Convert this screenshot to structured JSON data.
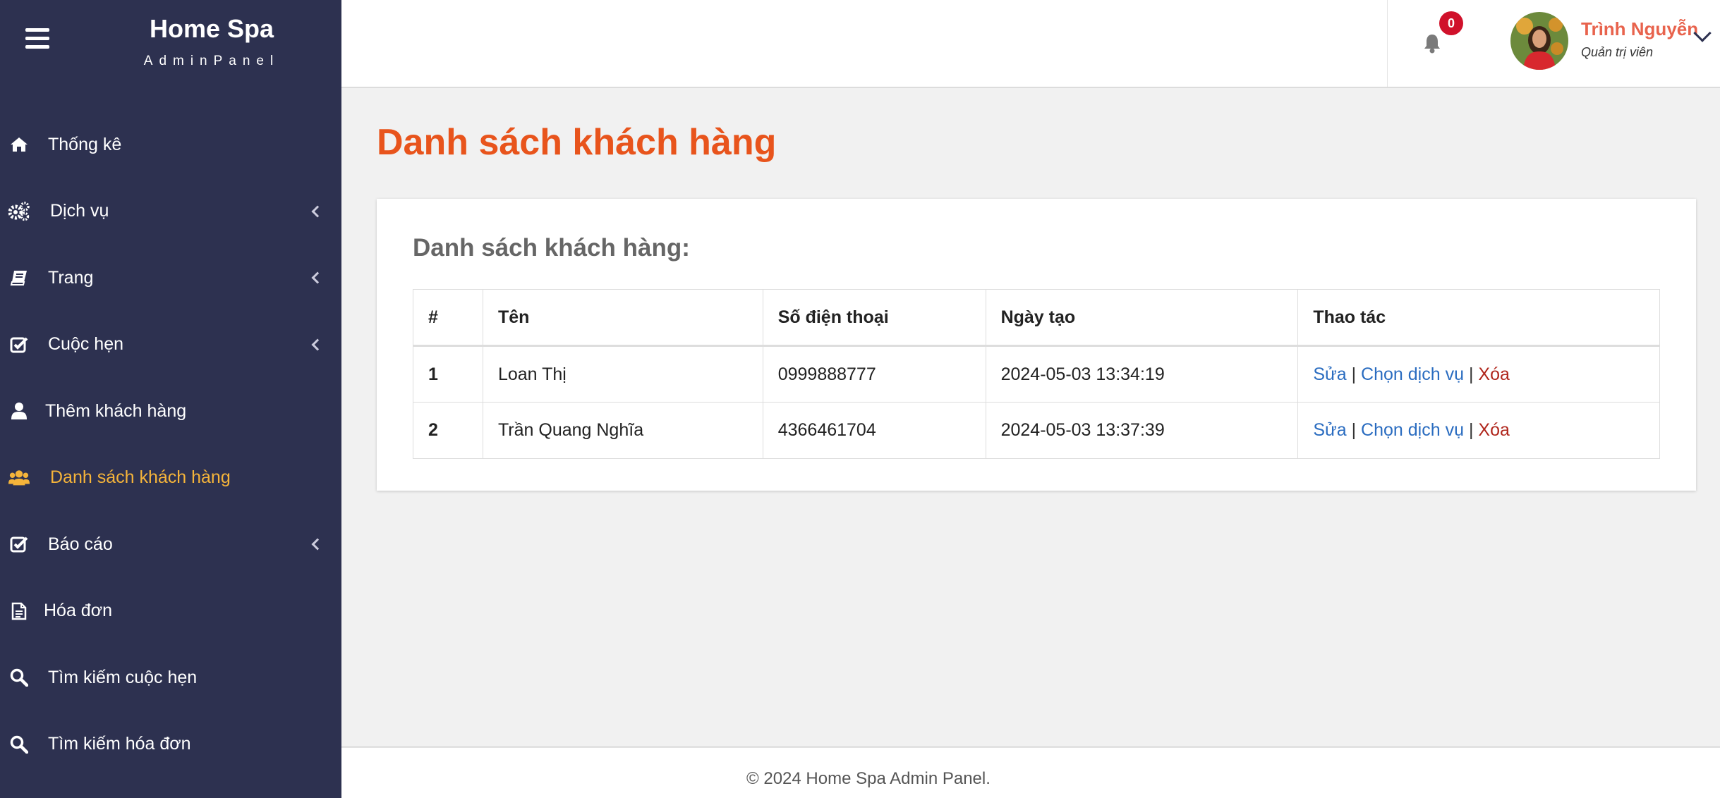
{
  "brand": {
    "title": "Home Spa",
    "subtitle": "AdminPanel"
  },
  "sidebar": {
    "items": [
      {
        "label": "Thống kê",
        "icon": "home-icon",
        "has_submenu": false,
        "active": false
      },
      {
        "label": "Dịch vụ",
        "icon": "gears-icon",
        "has_submenu": true,
        "active": false
      },
      {
        "label": "Trang",
        "icon": "book-icon",
        "has_submenu": true,
        "active": false
      },
      {
        "label": "Cuộc hẹn",
        "icon": "check-square-icon",
        "has_submenu": true,
        "active": false
      },
      {
        "label": "Thêm khách hàng",
        "icon": "user-icon",
        "has_submenu": false,
        "active": false
      },
      {
        "label": "Danh sách khách hàng",
        "icon": "users-icon",
        "has_submenu": false,
        "active": true
      },
      {
        "label": "Báo cáo",
        "icon": "check-square-icon",
        "has_submenu": true,
        "active": false
      },
      {
        "label": "Hóa đơn",
        "icon": "file-text-icon",
        "has_submenu": false,
        "active": false
      },
      {
        "label": "Tìm kiếm cuộc hẹn",
        "icon": "search-icon",
        "has_submenu": false,
        "active": false
      },
      {
        "label": "Tìm kiếm hóa đơn",
        "icon": "search-icon",
        "has_submenu": false,
        "active": false
      }
    ]
  },
  "topbar": {
    "notification_count": "0",
    "user": {
      "name": "Trình Nguyễn",
      "role": "Quản trị viên"
    }
  },
  "main": {
    "page_title": "Danh sách khách hàng",
    "card_title": "Danh sách khách hàng:",
    "table": {
      "headers": [
        "#",
        "Tên",
        "Số điện thoại",
        "Ngày tạo",
        "Thao tác"
      ],
      "rows": [
        {
          "index": "1",
          "name": "Loan Thị",
          "phone": "0999888777",
          "created": "2024-05-03 13:34:19"
        },
        {
          "index": "2",
          "name": "Trần Quang Nghĩa",
          "phone": "4366461704",
          "created": "2024-05-03 13:37:39"
        }
      ],
      "actions": {
        "edit": "Sửa",
        "choose_service": "Chọn dịch vụ",
        "delete": "Xóa",
        "separator": "|"
      }
    }
  },
  "footer": {
    "text": "© 2024 Home Spa Admin Panel."
  },
  "colors": {
    "sidebar_bg": "#2d3150",
    "active": "#f5b43a",
    "title": "#e8541c",
    "link": "#2a6cc0",
    "danger": "#b0271d",
    "badge": "#d0112b"
  }
}
